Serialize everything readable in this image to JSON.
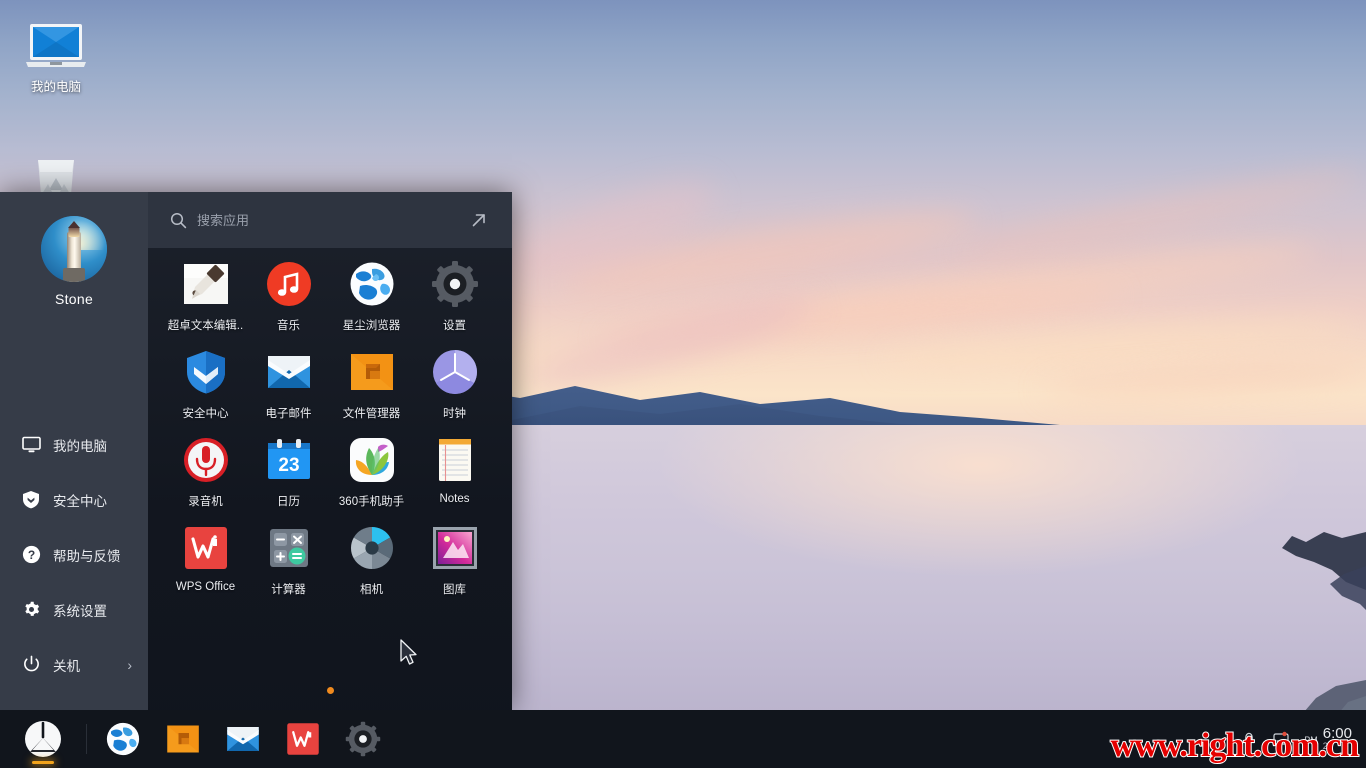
{
  "desktop": {
    "icons": [
      {
        "label": "我的电脑",
        "icon": "monitor-icon"
      },
      {
        "label": "",
        "icon": "trash-icon"
      }
    ]
  },
  "start_menu": {
    "user": {
      "name": "Stone",
      "avatar": "lighthouse-avatar"
    },
    "nav_items": [
      {
        "label": "我的电脑",
        "icon": "monitor-icon",
        "chevron": ""
      },
      {
        "label": "安全中心",
        "icon": "shield-icon",
        "chevron": ""
      },
      {
        "label": "帮助与反馈",
        "icon": "question-circle-icon",
        "chevron": ""
      },
      {
        "label": "系统设置",
        "icon": "gear-icon",
        "chevron": ""
      },
      {
        "label": "关机",
        "icon": "power-icon",
        "chevron": "›"
      }
    ],
    "search": {
      "placeholder": "搜索应用",
      "value": "",
      "icon": "search-icon"
    },
    "expand_icon": "expand-arrow-icon",
    "apps": [
      {
        "label": "超卓文本编辑..",
        "icon": "text-editor-icon"
      },
      {
        "label": "音乐",
        "icon": "music-icon"
      },
      {
        "label": "星尘浏览器",
        "icon": "browser-globe-icon"
      },
      {
        "label": "设置",
        "icon": "settings-gear-icon"
      },
      {
        "label": "安全中心",
        "icon": "security-shield-icon"
      },
      {
        "label": "电子邮件",
        "icon": "mail-envelope-icon"
      },
      {
        "label": "文件管理器",
        "icon": "file-manager-icon"
      },
      {
        "label": "时钟",
        "icon": "clock-icon"
      },
      {
        "label": "录音机",
        "icon": "voice-recorder-icon"
      },
      {
        "label": "日历",
        "icon": "calendar-icon"
      },
      {
        "label": "360手机助手",
        "icon": "360-assistant-icon"
      },
      {
        "label": "Notes",
        "icon": "notes-icon"
      },
      {
        "label": "WPS Office",
        "icon": "wps-office-icon"
      },
      {
        "label": "计算器",
        "icon": "calculator-icon"
      },
      {
        "label": "相机",
        "icon": "camera-icon"
      },
      {
        "label": "图库",
        "icon": "gallery-icon"
      }
    ],
    "page_indicator": {
      "pages": 1,
      "current": 1,
      "color": "#f08a1e"
    }
  },
  "taskbar": {
    "start_button": {
      "icon": "start-logo-icon",
      "active": true
    },
    "pinned": [
      {
        "label": "星尘浏览器",
        "icon": "browser-globe-icon"
      },
      {
        "label": "文件管理器",
        "icon": "file-manager-icon"
      },
      {
        "label": "电子邮件",
        "icon": "mail-envelope-icon"
      },
      {
        "label": "WPS Office",
        "icon": "wps-office-icon"
      },
      {
        "label": "设置",
        "icon": "settings-gear-icon"
      }
    ],
    "clock": {
      "ampm": "PM",
      "time": "6:00",
      "date": "20"
    }
  },
  "watermark": {
    "text": "www.right.com.cn",
    "color": "#e50000"
  },
  "colors": {
    "sidebar_bg": "#363c48",
    "panel_bg": "#2e3440",
    "taskbar_bg": "#11151c",
    "accent": "#f08a1e"
  }
}
